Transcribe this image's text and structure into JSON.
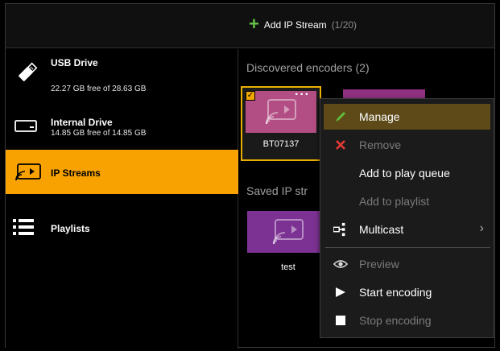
{
  "toolbar": {
    "add_label": "Add IP Stream",
    "add_count": "(1/20)"
  },
  "sidebar": {
    "items": [
      {
        "id": "usb",
        "label": "USB Drive",
        "sub": "22.27 GB free of 28.63 GB",
        "icon": "usb-drive-icon"
      },
      {
        "id": "internal",
        "label": "Internal Drive",
        "sub": "14.85 GB free of 14.85 GB",
        "icon": "hard-drive-icon"
      },
      {
        "id": "ip",
        "label": "IP Streams",
        "icon": "ip-stream-icon",
        "selected": true
      },
      {
        "id": "playlists",
        "label": "Playlists",
        "icon": "list-icon"
      }
    ]
  },
  "main": {
    "discovered_title": "Discovered encoders",
    "discovered_count": "(2)",
    "saved_title": "Saved IP str",
    "encoders": [
      {
        "name": "BT07137",
        "checked": true,
        "color": "#b24e83"
      },
      {
        "name": "",
        "color": "#8f3180"
      }
    ],
    "saved": [
      {
        "name": "test",
        "color": "#7c3292"
      }
    ]
  },
  "context_menu": {
    "items": [
      {
        "id": "manage",
        "label": "Manage",
        "icon": "pencil-icon",
        "enabled": true,
        "highlighted": true
      },
      {
        "id": "remove",
        "label": "Remove",
        "icon": "x-icon",
        "enabled": false
      },
      {
        "id": "queue",
        "label": "Add to play queue",
        "enabled": true
      },
      {
        "id": "playlist",
        "label": "Add to playlist",
        "enabled": false
      },
      {
        "id": "multicast",
        "label": "Multicast",
        "icon": "multicast-icon",
        "enabled": true,
        "submenu": true
      },
      {
        "id": "preview",
        "label": "Preview",
        "icon": "eye-icon",
        "enabled": false
      },
      {
        "id": "start",
        "label": "Start encoding",
        "icon": "play-icon",
        "enabled": true
      },
      {
        "id": "stop",
        "label": "Stop encoding",
        "icon": "stop-icon",
        "enabled": false
      }
    ]
  },
  "colors": {
    "accent": "#f7a200",
    "menu_highlight": "#5e4a19",
    "plus_green": "#66c24a",
    "remove_red": "#e53935"
  }
}
